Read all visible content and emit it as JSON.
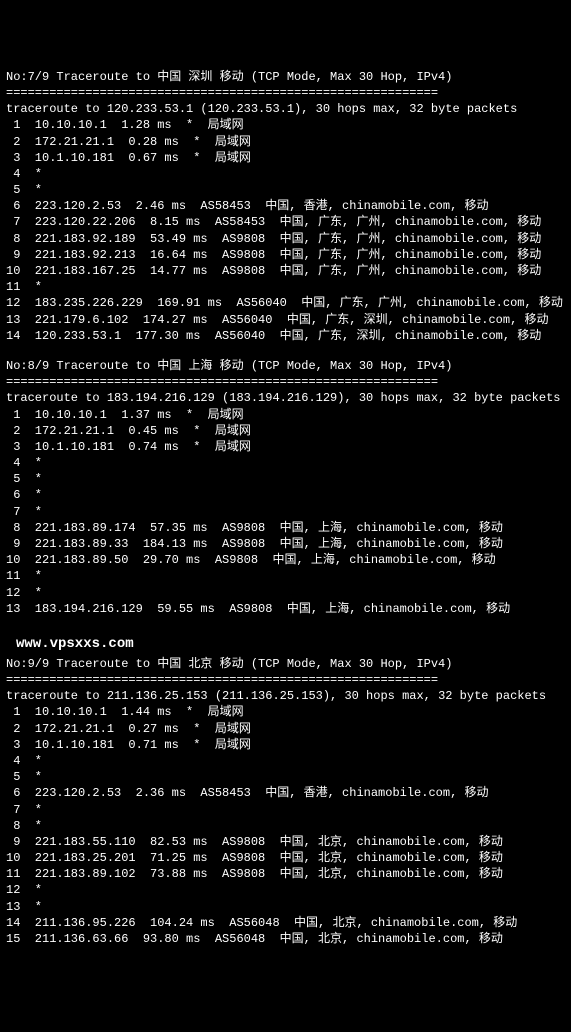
{
  "blocks": [
    {
      "header": "No:7/9 Traceroute to 中国 深圳 移动 (TCP Mode, Max 30 Hop, IPv4)",
      "divider": "============================================================",
      "sub": "traceroute to 120.233.53.1 (120.233.53.1), 30 hops max, 32 byte packets",
      "hops": [
        " 1  10.10.10.1  1.28 ms  *  局域网",
        " 2  172.21.21.1  0.28 ms  *  局域网",
        " 3  10.1.10.181  0.67 ms  *  局域网",
        " 4  *",
        " 5  *",
        " 6  223.120.2.53  2.46 ms  AS58453  中国, 香港, chinamobile.com, 移动",
        " 7  223.120.22.206  8.15 ms  AS58453  中国, 广东, 广州, chinamobile.com, 移动",
        " 8  221.183.92.189  53.49 ms  AS9808  中国, 广东, 广州, chinamobile.com, 移动",
        " 9  221.183.92.213  16.64 ms  AS9808  中国, 广东, 广州, chinamobile.com, 移动",
        "10  221.183.167.25  14.77 ms  AS9808  中国, 广东, 广州, chinamobile.com, 移动",
        "11  *",
        "12  183.235.226.229  169.91 ms  AS56040  中国, 广东, 广州, chinamobile.com, 移动",
        "13  221.179.6.102  174.27 ms  AS56040  中国, 广东, 深圳, chinamobile.com, 移动",
        "14  120.233.53.1  177.30 ms  AS56040  中国, 广东, 深圳, chinamobile.com, 移动"
      ]
    },
    {
      "header": "No:8/9 Traceroute to 中国 上海 移动 (TCP Mode, Max 30 Hop, IPv4)",
      "divider": "============================================================",
      "sub": "traceroute to 183.194.216.129 (183.194.216.129), 30 hops max, 32 byte packets",
      "hops": [
        " 1  10.10.10.1  1.37 ms  *  局域网",
        " 2  172.21.21.1  0.45 ms  *  局域网",
        " 3  10.1.10.181  0.74 ms  *  局域网",
        " 4  *",
        " 5  *",
        " 6  *",
        " 7  *",
        " 8  221.183.89.174  57.35 ms  AS9808  中国, 上海, chinamobile.com, 移动",
        " 9  221.183.89.33  184.13 ms  AS9808  中国, 上海, chinamobile.com, 移动",
        "10  221.183.89.50  29.70 ms  AS9808  中国, 上海, chinamobile.com, 移动",
        "11  *",
        "12  *",
        "13  183.194.216.129  59.55 ms  AS9808  中国, 上海, chinamobile.com, 移动"
      ]
    },
    {
      "header": "No:9/9 Traceroute to 中国 北京 移动 (TCP Mode, Max 30 Hop, IPv4)",
      "divider": "============================================================",
      "sub": "traceroute to 211.136.25.153 (211.136.25.153), 30 hops max, 32 byte packets",
      "hops": [
        " 1  10.10.10.1  1.44 ms  *  局域网",
        " 2  172.21.21.1  0.27 ms  *  局域网",
        " 3  10.1.10.181  0.71 ms  *  局域网",
        " 4  *",
        " 5  *",
        " 6  223.120.2.53  2.36 ms  AS58453  中国, 香港, chinamobile.com, 移动",
        " 7  *",
        " 8  *",
        " 9  221.183.55.110  82.53 ms  AS9808  中国, 北京, chinamobile.com, 移动",
        "10  221.183.25.201  71.25 ms  AS9808  中国, 北京, chinamobile.com, 移动",
        "11  221.183.89.102  73.88 ms  AS9808  中国, 北京, chinamobile.com, 移动",
        "12  *",
        "13  *",
        "14  211.136.95.226  104.24 ms  AS56048  中国, 北京, chinamobile.com, 移动",
        "15  211.136.63.66  93.80 ms  AS56048  中国, 北京, chinamobile.com, 移动"
      ]
    }
  ],
  "watermark": "www.vpsxxs.com"
}
